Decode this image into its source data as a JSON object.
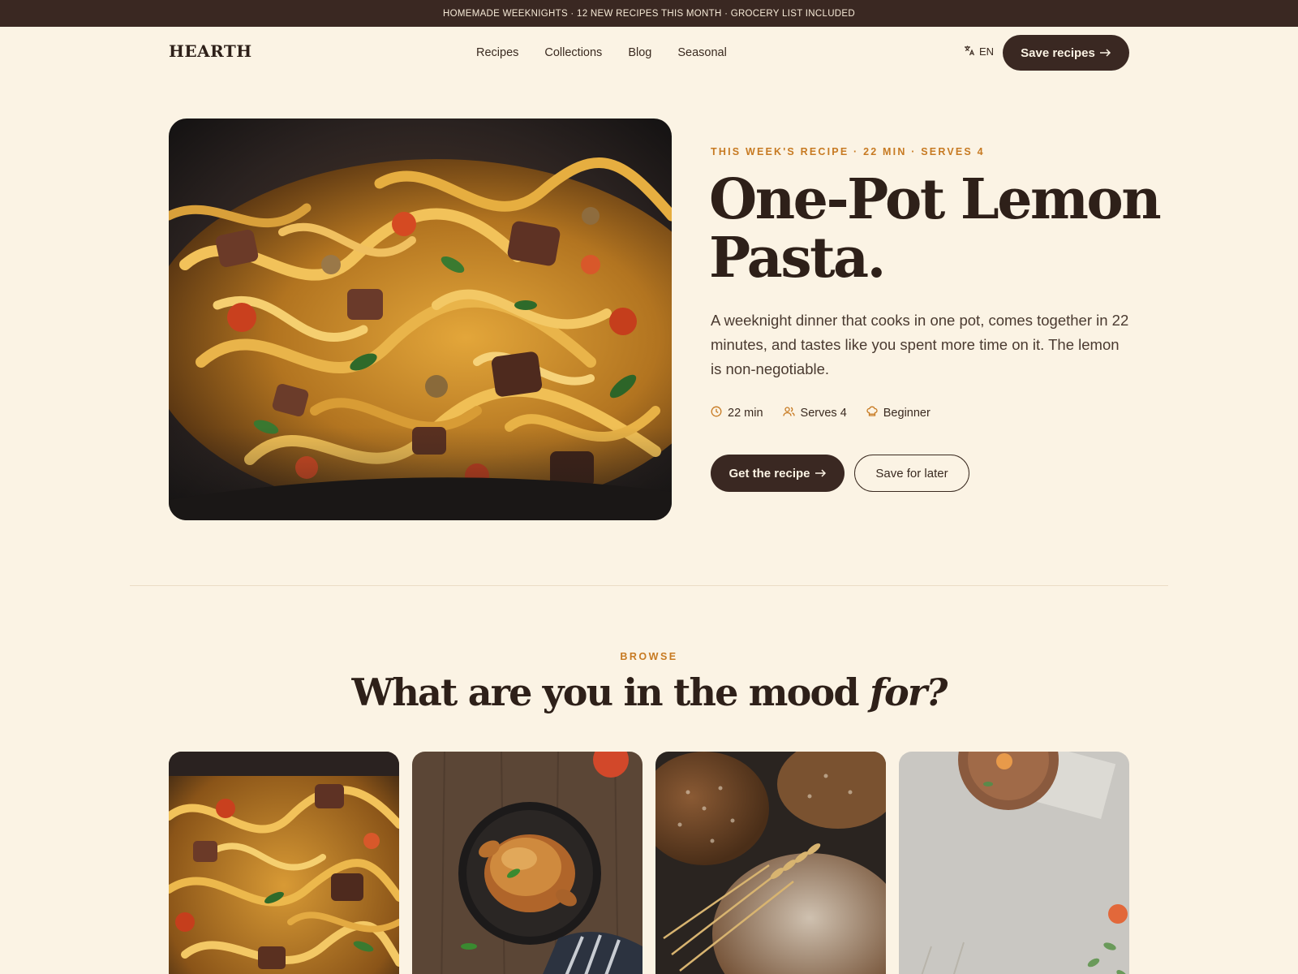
{
  "announcement": "HOMEMADE WEEKNIGHTS · 12 NEW RECIPES THIS MONTH · GROCERY LIST INCLUDED",
  "header": {
    "logo": "HEARTH",
    "nav": [
      "Recipes",
      "Collections",
      "Blog",
      "Seasonal"
    ],
    "lang": "EN",
    "cta": "Save recipes"
  },
  "hero": {
    "kicker": "THIS WEEK'S RECIPE · 22 MIN · SERVES 4",
    "title_line1": "One-Pot Lemon",
    "title_line2": "Pasta.",
    "description": "A weeknight dinner that cooks in one pot, comes together in 22 minutes, and tastes like you spent more time on it. The lemon is non-negotiable.",
    "meta": {
      "time": "22 min",
      "serves": "Serves 4",
      "level": "Beginner"
    },
    "primary_button": "Get the recipe",
    "secondary_button": "Save for later"
  },
  "browse": {
    "kicker": "BROWSE",
    "title_main": "What are you in the mood ",
    "title_italic": "for?"
  },
  "icons": {
    "arrow": "arrow-right-icon",
    "translate": "translate-icon",
    "clock": "clock-icon",
    "people": "users-icon",
    "chef": "chef-hat-icon"
  },
  "colors": {
    "background": "#fbf3e4",
    "dark": "#3a2822",
    "accent": "#c77a22"
  }
}
